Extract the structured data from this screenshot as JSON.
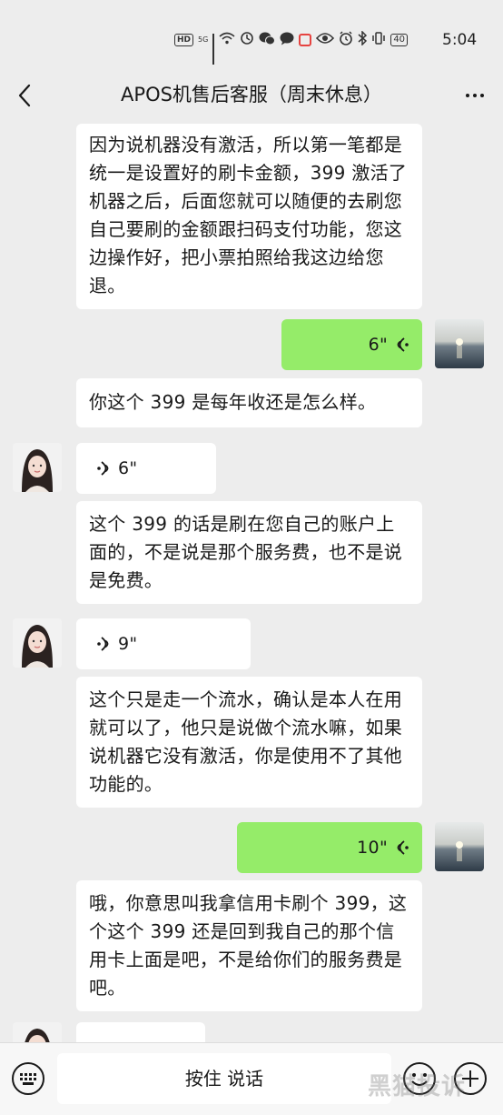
{
  "status_bar": {
    "time": "5:04",
    "battery": "40",
    "network": "5G",
    "hd": "HD"
  },
  "header": {
    "title": "APOS机售后客服（周末休息）"
  },
  "messages": [
    {
      "side": "left",
      "kind": "text",
      "text": "因为说机器没有激活，所以第一笔都是统一是设置好的刷卡金额，399 激活了机器之后，后面您就可以随便的去刷您自己要刷的金额跟扫码支付功能，您这边操作好，把小票拍照给我这边给您退。"
    },
    {
      "side": "right",
      "kind": "voice",
      "duration": "6\""
    },
    {
      "side": "left",
      "kind": "text",
      "text": "你这个 399 是每年收还是怎么样。"
    },
    {
      "side": "left",
      "kind": "voice",
      "duration": "6\""
    },
    {
      "side": "left",
      "kind": "text",
      "text": "这个 399 的话是刷在您自己的账户上面的，不是说是那个服务费，也不是说是免费。"
    },
    {
      "side": "left",
      "kind": "voice",
      "duration": "9\""
    },
    {
      "side": "left",
      "kind": "text",
      "text": "这个只是走一个流水，确认是本人在用就可以了，他只是说做个流水嘛，如果说机器它没有激活，你是使用不了其他功能的。"
    },
    {
      "side": "right",
      "kind": "voice",
      "duration": "10\""
    },
    {
      "side": "left",
      "kind": "text",
      "text": "哦，你意思叫我拿信用卡刷个 399，这个这个 399 还是回到我自己的那个信用卡上面是吧，不是给你们的服务费是吧。"
    }
  ],
  "input": {
    "hold_to_talk": "按住 说话"
  },
  "watermark": "黑猫投诉",
  "colors": {
    "background": "#ededed",
    "own_bubble": "#95ec69",
    "other_bubble": "#ffffff"
  }
}
